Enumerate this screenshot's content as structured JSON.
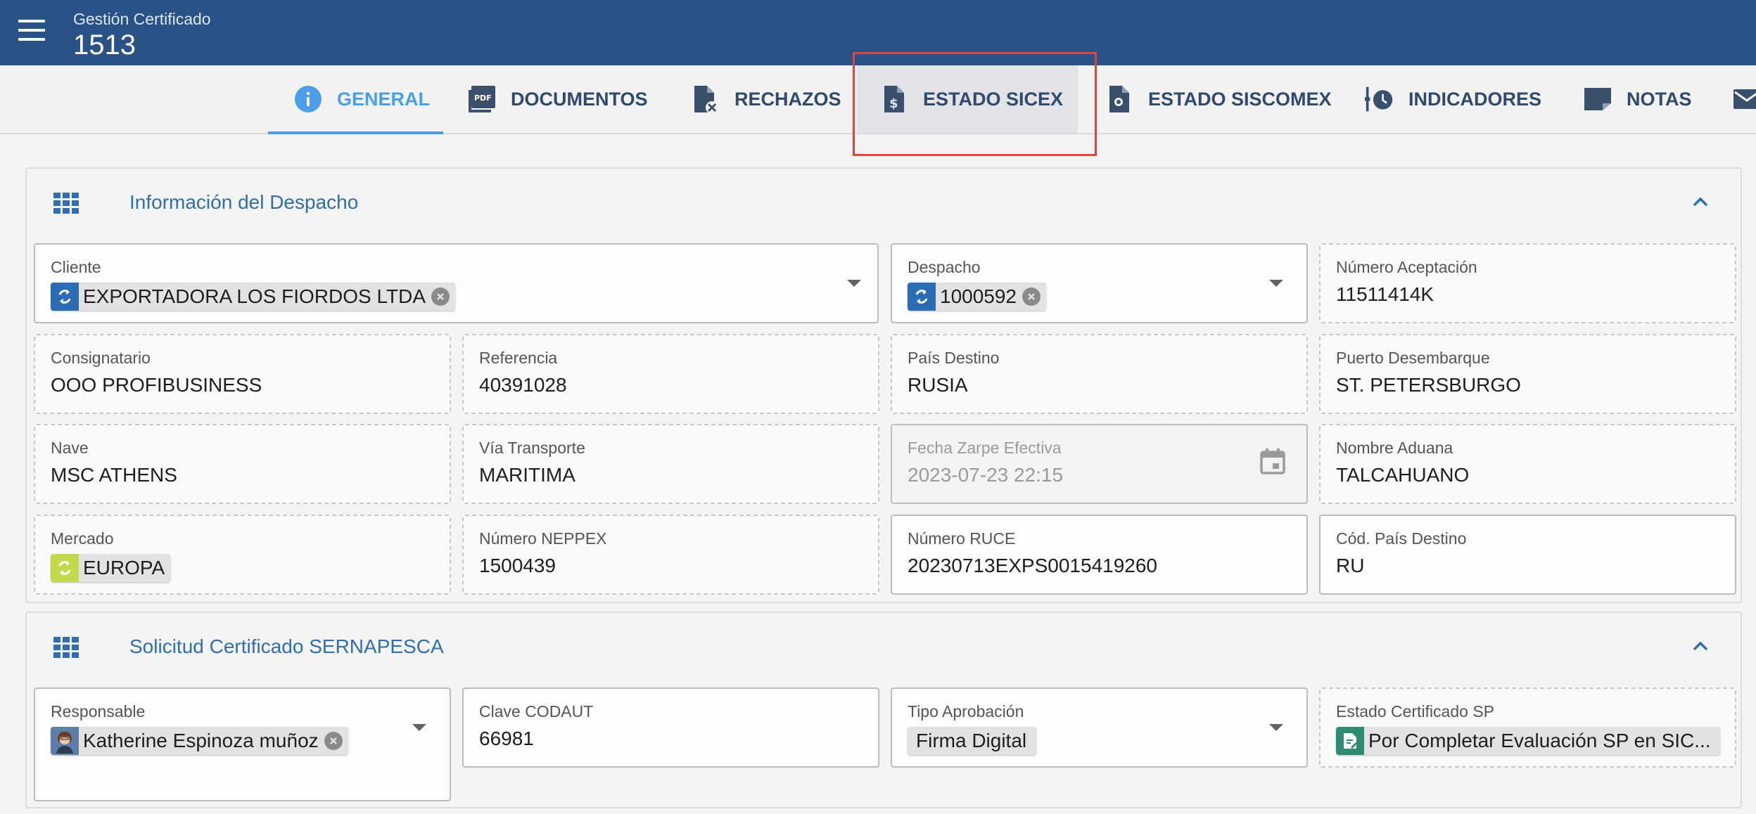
{
  "header": {
    "subtitle": "Gestión Certificado",
    "title": "1513"
  },
  "tabs": {
    "general": "GENERAL",
    "documentos": "DOCUMENTOS",
    "rechazos": "RECHAZOS",
    "estado_sicex": "ESTADO SICEX",
    "estado_siscomex": "ESTADO SISCOMEX",
    "indicadores": "INDICADORES",
    "notas": "NOTAS"
  },
  "section1": {
    "title": "Información del Despacho",
    "fields": {
      "cliente": {
        "label": "Cliente",
        "value": "EXPORTADORA LOS FIORDOS LTDA"
      },
      "despacho": {
        "label": "Despacho",
        "value": "1000592"
      },
      "numero_aceptacion": {
        "label": "Número Aceptación",
        "value": "11511414K"
      },
      "consignatario": {
        "label": "Consignatario",
        "value": "OOO PROFIBUSINESS"
      },
      "referencia": {
        "label": "Referencia",
        "value": "40391028"
      },
      "pais_destino": {
        "label": "País Destino",
        "value": "RUSIA"
      },
      "puerto_desembarque": {
        "label": "Puerto Desembarque",
        "value": "ST. PETERSBURGO"
      },
      "nave": {
        "label": "Nave",
        "value": "MSC ATHENS"
      },
      "via_transporte": {
        "label": "Vía Transporte",
        "value": "MARITIMA"
      },
      "fecha_zarpe": {
        "label": "Fecha Zarpe Efectiva",
        "value": "2023-07-23 22:15"
      },
      "nombre_aduana": {
        "label": "Nombre Aduana",
        "value": "TALCAHUANO"
      },
      "mercado": {
        "label": "Mercado",
        "value": "EUROPA"
      },
      "numero_neppex": {
        "label": "Número NEPPEX",
        "value": "1500439"
      },
      "numero_ruce": {
        "label": "Número RUCE",
        "value": "20230713EXPS0015419260"
      },
      "cod_pais_destino": {
        "label": "Cód. País Destino",
        "value": "RU"
      }
    }
  },
  "section2": {
    "title": "Solicitud Certificado SERNAPESCA",
    "fields": {
      "responsable": {
        "label": "Responsable",
        "value": "Katherine Espinoza muñoz"
      },
      "clave_codaut": {
        "label": "Clave CODAUT",
        "value": "66981"
      },
      "tipo_aprobacion": {
        "label": "Tipo Aprobación",
        "value": "Firma Digital"
      },
      "estado_certificado": {
        "label": "Estado Certificado SP",
        "value": "Por Completar Evaluación SP en SIC..."
      }
    }
  },
  "colors": {
    "header_bg": "#295287",
    "active_tab": "#4a9fe8",
    "section_title": "#2f6eb0",
    "highlight_box": "#e0453a",
    "chip_blue": "#2a6db4",
    "chip_green": "#c4d94a",
    "chip_teal": "#2e8b74"
  },
  "icons": {
    "menu": "hamburger-icon",
    "general": "info-icon",
    "documentos": "pdf-icon",
    "rechazos": "file-x-icon",
    "estado_sicex": "file-currency-icon",
    "estado_siscomex": "file-badge-icon",
    "indicadores": "timeline-clock-icon",
    "notas": "note-icon",
    "section": "grid-icon",
    "collapse": "chevron-up-icon",
    "calendar": "calendar-icon"
  }
}
